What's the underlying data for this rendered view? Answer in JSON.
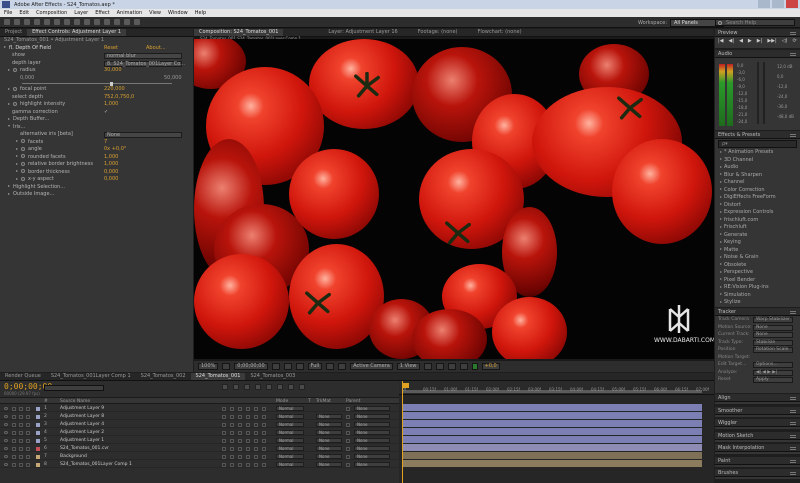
{
  "window": {
    "title": "Adobe After Effects - S24_Tomatos.aep *"
  },
  "menu": [
    "File",
    "Edit",
    "Composition",
    "Layer",
    "Effect",
    "Animation",
    "View",
    "Window",
    "Help"
  ],
  "toolbar": {
    "workspace_label": "Workspace:",
    "workspace_value": "All Panels",
    "search_placeholder": "Search Help"
  },
  "left_panel": {
    "tabs": [
      "Project",
      "Effect Controls: Adjustment Layer 1"
    ],
    "breadcrumb": "S24_Tomatos_001 • Adjustment Layer 1",
    "effect_name": "fl. Depth Of Field",
    "reset": "Reset",
    "about": "About...",
    "params": [
      {
        "label": "show",
        "value": "normal blur",
        "type": "dropdown"
      },
      {
        "label": "depth layer",
        "value": "8. S24_Tomatos_001Layer Co...",
        "type": "dropdown"
      },
      {
        "label": "radius",
        "value": "30,000",
        "type": "value"
      },
      {
        "label": "0,000",
        "value": "50,000",
        "type": "range"
      },
      {
        "label": "focal point",
        "value": "220,000",
        "type": "value"
      },
      {
        "label": "select depth",
        "value": "752,0,750,0",
        "type": "value"
      },
      {
        "label": "highlight intensity",
        "value": "1,000",
        "type": "value"
      },
      {
        "label": "gamma correction",
        "value": "✓",
        "type": "check"
      },
      {
        "label": "Depth Buffer...",
        "value": "",
        "type": "group"
      },
      {
        "label": "Iris...",
        "value": "",
        "type": "group"
      },
      {
        "label": "alternative iris [beta]",
        "value": "None",
        "type": "dropdown"
      },
      {
        "label": "facets",
        "value": "7",
        "type": "value"
      },
      {
        "label": "angle",
        "value": "0x +0,0°",
        "type": "value"
      },
      {
        "label": "rounded facets",
        "value": "1,000",
        "type": "value"
      },
      {
        "label": "relative border brightness",
        "value": "1,000",
        "type": "value"
      },
      {
        "label": "border thickness",
        "value": "0,000",
        "type": "value"
      },
      {
        "label": "x-y aspect",
        "value": "0,000",
        "type": "value"
      },
      {
        "label": "Highlight Selection...",
        "value": "",
        "type": "group"
      },
      {
        "label": "Outside Image...",
        "value": "",
        "type": "group"
      }
    ]
  },
  "comp_panel": {
    "tabs": [
      "Composition: S24_Tomatos_001",
      "Layer: Adjustment Layer 16",
      "Footage: (none)",
      "Flowchart: (none)"
    ],
    "subtab": "S24_Tomatos_001   S24_Tomatos_001Layer Comp 1",
    "watermark_url": "WWW.DABARTI.COM",
    "viewer_bar": {
      "zoom": "100%",
      "timecode": "0;00;00;00",
      "resolution": "Full",
      "camera": "Active Camera",
      "views": "1 View",
      "exposure": "+0,0"
    }
  },
  "right_panels": {
    "preview": {
      "title": "Preview",
      "buttons": [
        "|◀",
        "◀|",
        "◀",
        "▶",
        "▶|",
        "▶▶|",
        "◁)",
        "⟳"
      ]
    },
    "audio": {
      "title": "Audio",
      "db_left": [
        "0,0",
        "-3,0",
        "-6,0",
        "-9,0",
        "-12,0",
        "-15,0",
        "-18,0",
        "-21,0",
        "-24,0"
      ],
      "db_right": [
        "12,0 dB",
        "0,0",
        "-12,0",
        "-24,0",
        "-36,0",
        "-48,0 dB"
      ]
    },
    "effects": {
      "title": "Effects & Presets",
      "search": "ρ▾",
      "items": [
        "* Animation Presets",
        "3D Channel",
        "Audio",
        "Blur & Sharpen",
        "Channel",
        "Color Correction",
        "DigiEffects FreeForm",
        "Distort",
        "Expression Controls",
        "frischluft.com",
        "Frischluft",
        "Generate",
        "Keying",
        "Matte",
        "Noise & Grain",
        "Obsolete",
        "Perspective",
        "Pixel Bender",
        "RE:Vision Plug-ins",
        "Simulation",
        "Stylize"
      ]
    },
    "tracker": {
      "title": "Tracker",
      "rows": [
        {
          "label": "Track Camera",
          "value": "Warp Stabilizer"
        },
        {
          "label": "Motion Source:",
          "value": "None"
        },
        {
          "label": "Current Track:",
          "value": "None"
        },
        {
          "label": "Track Type:",
          "value": "Stabilize"
        },
        {
          "label": "Position",
          "value": "Rotation  Scale"
        },
        {
          "label": "Motion Target:",
          "value": ""
        },
        {
          "label": "Edit Target...",
          "value": "Options..."
        },
        {
          "label": "Analyze:",
          "value": "◀| ◀ ▶ ▶|"
        },
        {
          "label": "Reset",
          "value": "Apply"
        }
      ]
    },
    "mini": [
      "Align",
      "Smoother",
      "Wiggler",
      "Motion Sketch",
      "Mask Interpolation",
      "Paint",
      "Brushes"
    ]
  },
  "timeline": {
    "tabs": [
      "Render Queue",
      "S24_Tomatos_001Layer Comp 1",
      "S24_Tomatos_002",
      "S24_Tomatos_001",
      "S24_Tomatos_003"
    ],
    "timecode": "0;00;00;00",
    "timecode_sub": "00000 (29.97 fps)",
    "columns": [
      "#",
      "Source Name",
      "Mode",
      "T",
      "TrkMat",
      "Parent"
    ],
    "ruler": [
      "0f",
      "00:15f",
      "01:00f",
      "01:15f",
      "02:00f",
      "02:15f",
      "03:00f",
      "03:15f",
      "04:00f",
      "04:15f",
      "05:00f",
      "05:15f",
      "06:00f",
      "06:15f",
      "07:00f"
    ],
    "layers": [
      {
        "num": "1",
        "name": "Adjustment Layer 9",
        "mode": "Normal",
        "trkmat": "",
        "parent": "None",
        "label": "#9aa3c7",
        "bar": "#7b7fb3"
      },
      {
        "num": "2",
        "name": "Adjustment Layer 8",
        "mode": "Normal",
        "trkmat": "None",
        "parent": "None",
        "label": "#9aa3c7",
        "bar": "#7b7fb3"
      },
      {
        "num": "3",
        "name": "Adjustment Layer 4",
        "mode": "Normal",
        "trkmat": "None",
        "parent": "None",
        "label": "#9aa3c7",
        "bar": "#7b7fb3"
      },
      {
        "num": "4",
        "name": "Adjustment Layer 2",
        "mode": "Normal",
        "trkmat": "None",
        "parent": "None",
        "label": "#9aa3c7",
        "bar": "#7b7fb3"
      },
      {
        "num": "5",
        "name": "Adjustment Layer 1",
        "mode": "Normal",
        "trkmat": "None",
        "parent": "None",
        "label": "#9aa3c7",
        "bar": "#7b7fb3"
      },
      {
        "num": "6",
        "name": "S24_Tomatos_001.cvr",
        "mode": "Normal",
        "trkmat": "None",
        "parent": "None",
        "label": "#c6505a",
        "bar": "#8e8bb4"
      },
      {
        "num": "7",
        "name": "Background",
        "mode": "Normal",
        "trkmat": "None",
        "parent": "None",
        "label": "#c6a878",
        "bar": "#7f7157"
      },
      {
        "num": "8",
        "name": "S24_Tomatos_001Layer Comp 1",
        "mode": "Normal",
        "trkmat": "None",
        "parent": "None",
        "label": "#c6a878",
        "bar": "#8c7c5e"
      }
    ]
  }
}
